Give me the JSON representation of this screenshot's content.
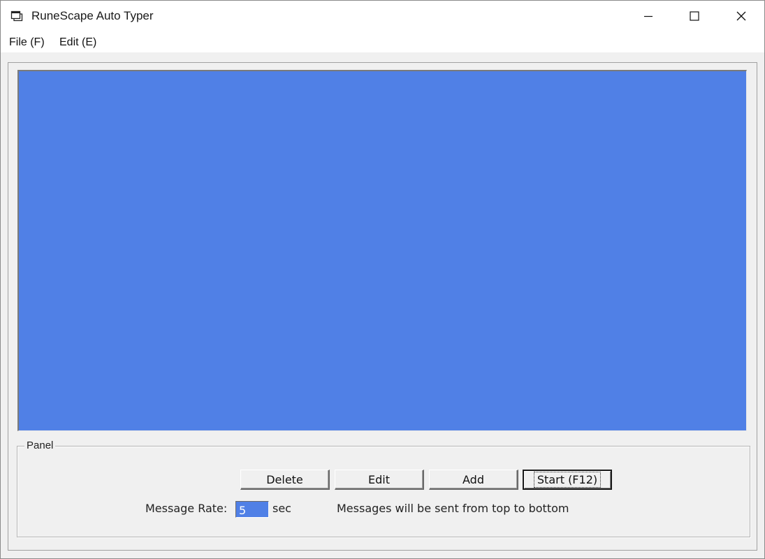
{
  "window": {
    "title": "RuneScape Auto Typer",
    "icon": "app-window-icon"
  },
  "menu": {
    "items": [
      {
        "label": "File (F)"
      },
      {
        "label": "Edit (E)"
      }
    ]
  },
  "message_list": {
    "items": [],
    "background": "#5080e6"
  },
  "panel": {
    "label": "Panel",
    "buttons": {
      "delete": "Delete",
      "edit": "Edit",
      "add": "Add",
      "start": "Start (F12)"
    },
    "rate_label": "Message Rate:",
    "rate_value": "5",
    "rate_unit": "sec",
    "note": "Messages will be sent from top to bottom"
  },
  "colors": {
    "selection_blue": "#5080e6",
    "face": "#f0f0f0"
  }
}
